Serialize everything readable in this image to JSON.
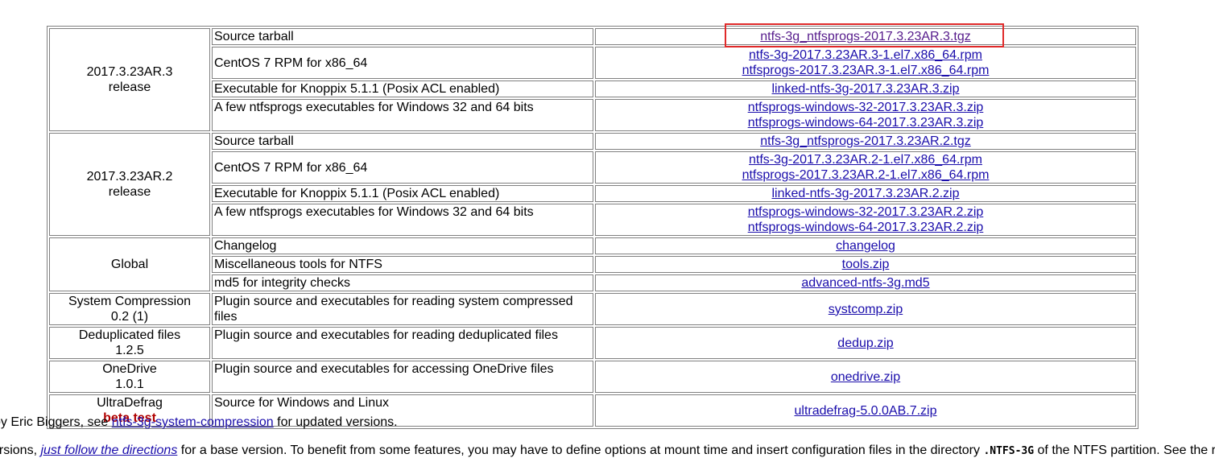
{
  "downloads": {
    "r3": {
      "version": "2017.3.23AR.3",
      "kind": "release",
      "rows": [
        {
          "desc": "Source tarball",
          "links": [
            "ntfs-3g_ntfsprogs-2017.3.23AR.3.tgz"
          ]
        },
        {
          "desc": "CentOS 7 RPM for x86_64",
          "links": [
            "ntfs-3g-2017.3.23AR.3-1.el7.x86_64.rpm",
            "ntfsprogs-2017.3.23AR.3-1.el7.x86_64.rpm"
          ]
        },
        {
          "desc": "Executable for Knoppix 5.1.1 (Posix ACL enabled)",
          "links": [
            "linked-ntfs-3g-2017.3.23AR.3.zip"
          ]
        },
        {
          "desc": "A few ntfsprogs executables for Windows 32 and 64 bits",
          "links": [
            "ntfsprogs-windows-32-2017.3.23AR.3.zip",
            "ntfsprogs-windows-64-2017.3.23AR.3.zip"
          ]
        }
      ]
    },
    "r2": {
      "version": "2017.3.23AR.2",
      "kind": "release",
      "rows": [
        {
          "desc": "Source tarball",
          "links": [
            "ntfs-3g_ntfsprogs-2017.3.23AR.2.tgz"
          ]
        },
        {
          "desc": "CentOS 7 RPM for x86_64",
          "links": [
            "ntfs-3g-2017.3.23AR.2-1.el7.x86_64.rpm",
            "ntfsprogs-2017.3.23AR.2-1.el7.x86_64.rpm"
          ]
        },
        {
          "desc": "Executable for Knoppix 5.1.1 (Posix ACL enabled)",
          "links": [
            "linked-ntfs-3g-2017.3.23AR.2.zip"
          ]
        },
        {
          "desc": "A few ntfsprogs executables for Windows 32 and 64 bits",
          "links": [
            "ntfsprogs-windows-32-2017.3.23AR.2.zip",
            "ntfsprogs-windows-64-2017.3.23AR.2.zip"
          ]
        }
      ]
    },
    "global": {
      "label": "Global",
      "rows": [
        {
          "desc": "Changelog",
          "links": [
            "changelog"
          ]
        },
        {
          "desc": "Miscellaneous tools for NTFS",
          "links": [
            "tools.zip"
          ]
        },
        {
          "desc": "md5 for integrity checks",
          "links": [
            "advanced-ntfs-3g.md5"
          ]
        }
      ]
    },
    "plugins": [
      {
        "name": "System Compression",
        "version": "0.2 (1)",
        "desc": "Plugin source and executables for reading system compressed files",
        "link": "systcomp.zip"
      },
      {
        "name": "Deduplicated files",
        "version": "1.2.5",
        "desc": "Plugin source and executables for reading deduplicated files",
        "link": "dedup.zip"
      },
      {
        "name": "OneDrive",
        "version": "1.0.1",
        "desc": "Plugin source and executables for accessing OneDrive files",
        "link": "onedrive.zip"
      }
    ],
    "ultradefrag": {
      "name": "UltraDefrag",
      "badge": "beta test",
      "desc": "Source for Windows and Linux",
      "link": "ultradefrag-5.0.0AB.7.zip"
    }
  },
  "footer": {
    "line1_pre": "by Eric Biggers, see ",
    "line1_link": "ntfs-3g-system-compression",
    "line1_post": " for updated versions.",
    "line2_pre": "ersions, ",
    "line2_link": "just follow the directions",
    "line2_mid": " for a base version. To benefit from some features, you may have to define options at mount time and insert configuration files in the directory ",
    "line2_code": ".NTFS-3G",
    "line2_post": " of the NTFS partition. See the releva"
  },
  "colors": {
    "link": "#1a0dab",
    "visited": "#551a8b",
    "beta": "#b00000",
    "highlight": "#e02a2a",
    "border": "#808080"
  }
}
